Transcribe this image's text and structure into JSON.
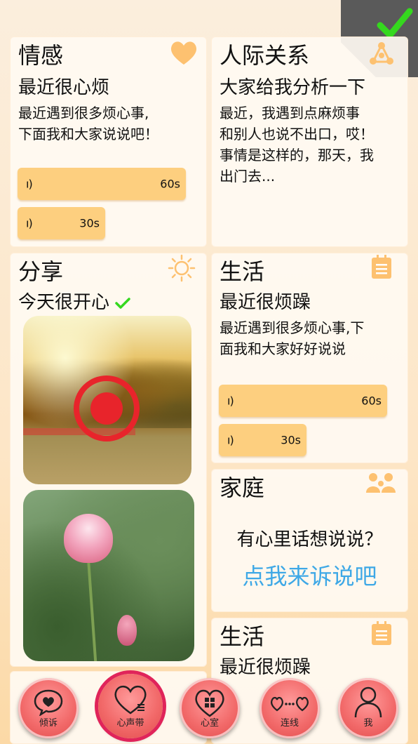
{
  "cards": {
    "emotion": {
      "category": "情感",
      "title": "最近很心烦",
      "body_line1": "最近遇到很多烦心事,",
      "body_line2": "下面我和大家说说吧！",
      "voice1": "60s",
      "voice2": "30s",
      "icon": "heart-icon"
    },
    "relations": {
      "category": "人际关系",
      "title": "大家给我分析一下",
      "body_line1": "最近，我遇到点麻烦事",
      "body_line2": "和别人也说不出口，哎！",
      "body_line3": "事情是这样的，那天，我",
      "body_line4": "出门去...",
      "icon": "network-icon"
    },
    "share": {
      "category": "分享",
      "title": "今天很开心",
      "icon": "sun-icon"
    },
    "life1": {
      "category": "生活",
      "title": "最近很烦躁",
      "body_line1": "最近遇到很多烦心事,下",
      "body_line2": "面我和大家好好说说",
      "voice1": "60s",
      "voice2": "30s",
      "icon": "clipboard-icon"
    },
    "family": {
      "category": "家庭",
      "prompt": "有心里话想说说？",
      "link": "点我来诉说吧",
      "icon": "family-icon"
    },
    "life2": {
      "category": "生活",
      "title": "最近很烦躁",
      "icon": "clipboard-icon"
    }
  },
  "voice_signal_glyph": "ı)",
  "nav": {
    "items": [
      {
        "label": "倾诉"
      },
      {
        "label": "心声带"
      },
      {
        "label": "心室"
      },
      {
        "label": "连线"
      },
      {
        "label": "我"
      }
    ]
  },
  "colors": {
    "accent_orange": "#fdc170",
    "voice_bar": "#fdcf7f",
    "link_blue": "#3ea8e6",
    "nav_red": "#f26a6a",
    "check_green": "#35d81e"
  }
}
